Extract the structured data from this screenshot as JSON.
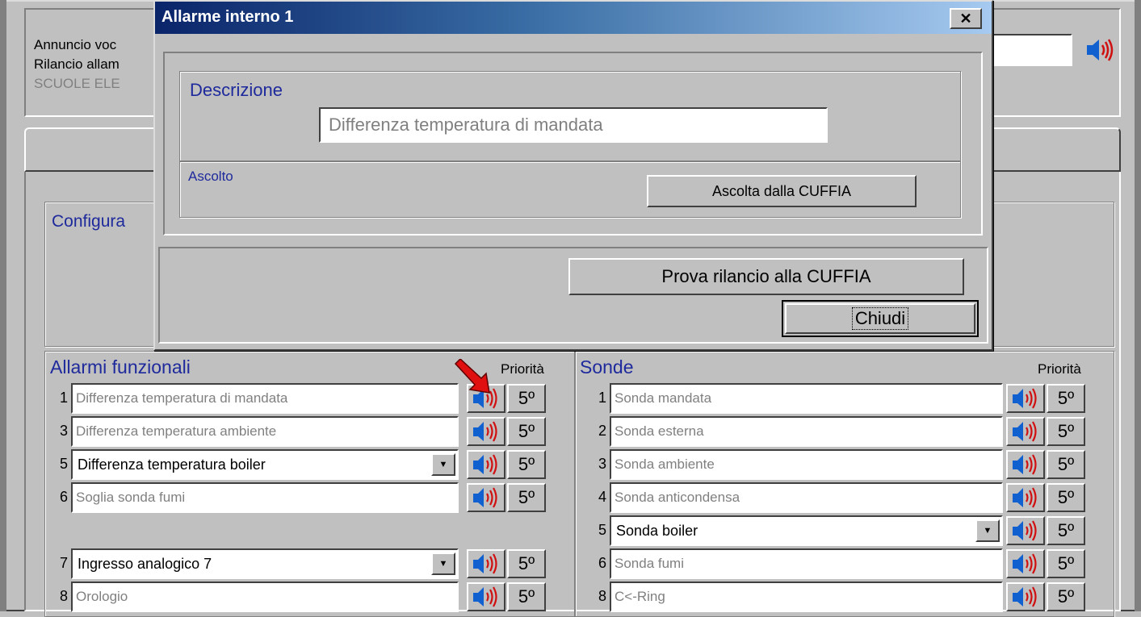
{
  "background": {
    "annuncio_label": "Annuncio voc",
    "rilancio_label": "Rilancio allam",
    "site_value": "SCUOLE ELE",
    "configura_label": "Configura"
  },
  "dialog": {
    "title": "Allarme interno 1",
    "close_symbol": "✕",
    "descrizione_label": "Descrizione",
    "descrizione_value": "Differenza temperatura di mandata",
    "ascolto_label": "Ascolto",
    "ascolta_button": "Ascolta dalla CUFFIA",
    "prova_button": "Prova rilancio alla CUFFIA",
    "chiudi_button": "Chiudi"
  },
  "allarmi": {
    "title": "Allarmi funzionali",
    "priority_header": "Priorità",
    "rows": [
      {
        "num": "1",
        "label": "Differenza temperatura di mandata",
        "priority": "5º",
        "combo": false
      },
      {
        "num": "3",
        "label": "Differenza temperatura ambiente",
        "priority": "5º",
        "combo": false
      },
      {
        "num": "5",
        "label": "Differenza temperatura boiler",
        "priority": "5º",
        "combo": true
      },
      {
        "num": "6",
        "label": "Soglia sonda fumi",
        "priority": "5º",
        "combo": false
      },
      {
        "num": "7",
        "label": "Ingresso analogico 7",
        "priority": "5º",
        "combo": true
      },
      {
        "num": "8",
        "label": "Orologio",
        "priority": "5º",
        "combo": false
      }
    ]
  },
  "sonde": {
    "title": "Sonde",
    "priority_header": "Priorità",
    "rows": [
      {
        "num": "1",
        "label": "Sonda mandata",
        "priority": "5º",
        "combo": false
      },
      {
        "num": "2",
        "label": "Sonda esterna",
        "priority": "5º",
        "combo": false
      },
      {
        "num": "3",
        "label": "Sonda ambiente",
        "priority": "5º",
        "combo": false
      },
      {
        "num": "4",
        "label": "Sonda anticondensa",
        "priority": "5º",
        "combo": false
      },
      {
        "num": "5",
        "label": "Sonda boiler",
        "priority": "5º",
        "combo": true
      },
      {
        "num": "6",
        "label": "Sonda fumi",
        "priority": "5º",
        "combo": false
      },
      {
        "num": "8",
        "label": "C<-Ring",
        "priority": "5º",
        "combo": false
      }
    ]
  },
  "icons": {
    "speaker": "speaker-icon",
    "combo_arrow": "▼",
    "pointer": "red-arrow-icon"
  },
  "colors": {
    "accent_blue": "#1e2a9c",
    "title_gradient_start": "#0a246a",
    "speaker_wave": "#d01010",
    "speaker_body": "#1060d0"
  }
}
